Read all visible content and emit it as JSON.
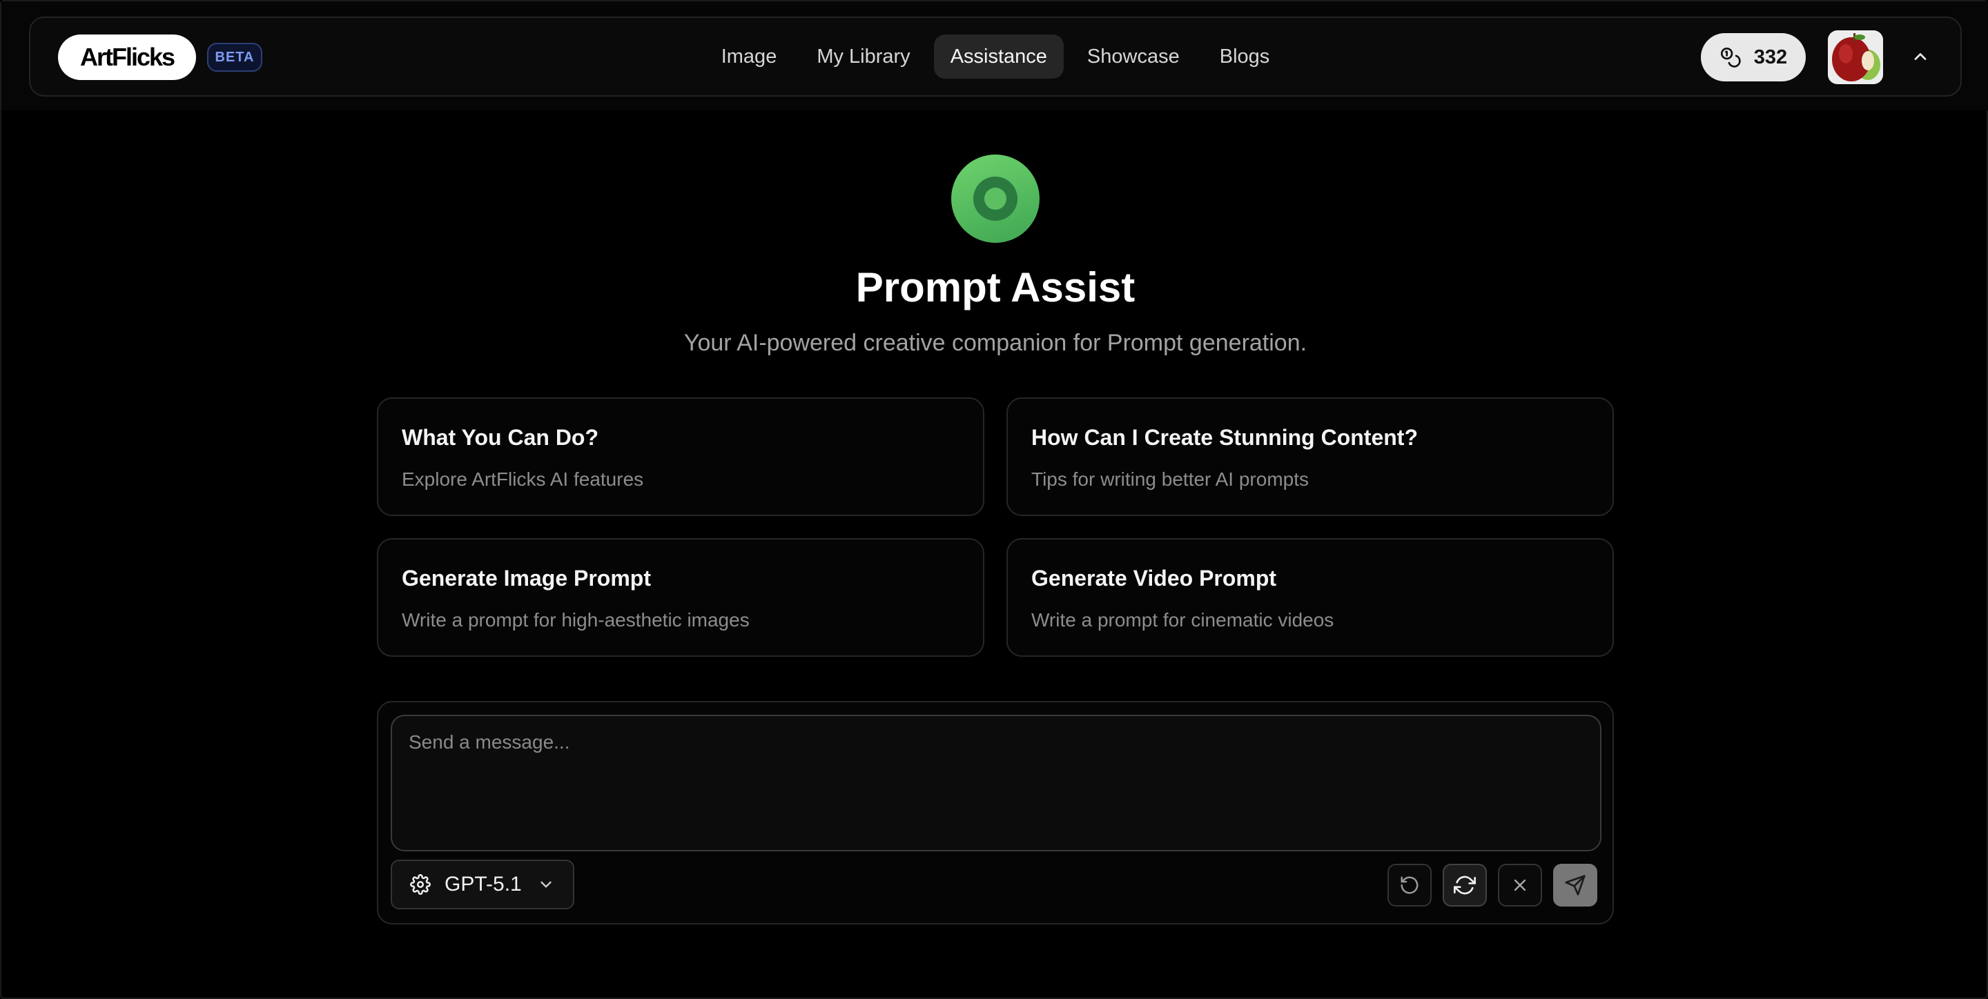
{
  "brand": {
    "logo_text": "ArtFlicks",
    "badge": "BETA"
  },
  "nav": {
    "items": [
      {
        "label": "Image"
      },
      {
        "label": "My Library"
      },
      {
        "label": "Assistance",
        "active": true
      },
      {
        "label": "Showcase"
      },
      {
        "label": "Blogs"
      }
    ]
  },
  "credits": {
    "count": "332"
  },
  "hero": {
    "title": "Prompt Assist",
    "subtitle": "Your AI-powered creative companion for Prompt generation."
  },
  "cards": [
    {
      "title": "What You Can Do?",
      "subtitle": "Explore ArtFlicks AI features"
    },
    {
      "title": "How Can I Create Stunning Content?",
      "subtitle": "Tips for writing better AI prompts"
    },
    {
      "title": "Generate Image Prompt",
      "subtitle": "Write a prompt for high-aesthetic images"
    },
    {
      "title": "Generate Video Prompt",
      "subtitle": "Write a prompt for cinematic videos"
    }
  ],
  "composer": {
    "placeholder": "Send a message...",
    "value": "",
    "model": "GPT-5.1"
  },
  "icons": {
    "credits": "coins-icon",
    "collapse": "chevron-up-icon",
    "hero": "target-icon",
    "model": "gear-icon",
    "model_dropdown": "chevron-down-icon",
    "undo": "undo-icon",
    "refresh": "refresh-icon",
    "clear": "close-icon",
    "send": "send-icon"
  },
  "colors": {
    "background": "#000000",
    "accent_green": "#4cb85c",
    "beta_blue": "#7e9cf2",
    "active_nav": "#262626"
  }
}
